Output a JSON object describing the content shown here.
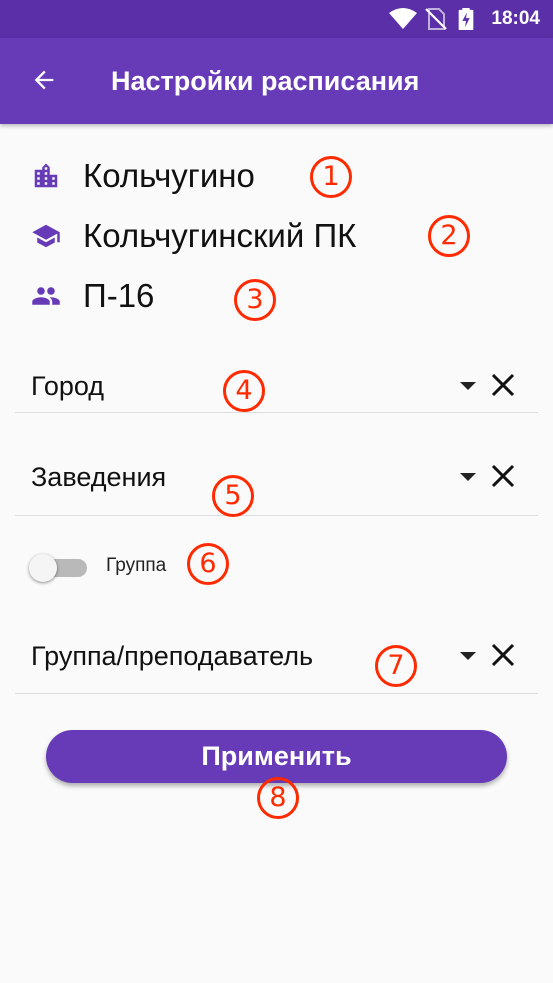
{
  "status_bar": {
    "time": "18:04",
    "icons": [
      "wifi-icon",
      "no-sim-icon",
      "battery-charging-icon"
    ]
  },
  "app_bar": {
    "title": "Настройки расписания",
    "back_icon": "arrow-back-icon"
  },
  "selection": {
    "city": "Кольчугино",
    "institution": "Кольчугинский ПК",
    "group": "П-16"
  },
  "fields": {
    "city_label": "Город",
    "institution_label": "Заведения",
    "group_teacher_label": "Группа/преподаватель"
  },
  "group_toggle": {
    "label": "Группа",
    "checked": false
  },
  "apply_button": {
    "label": "Применить"
  },
  "annotations": [
    "1",
    "2",
    "3",
    "4",
    "5",
    "6",
    "7",
    "8"
  ],
  "colors": {
    "primary": "#673ab7",
    "primary_dark": "#5a2fa8",
    "annotation": "#ff2a00"
  }
}
